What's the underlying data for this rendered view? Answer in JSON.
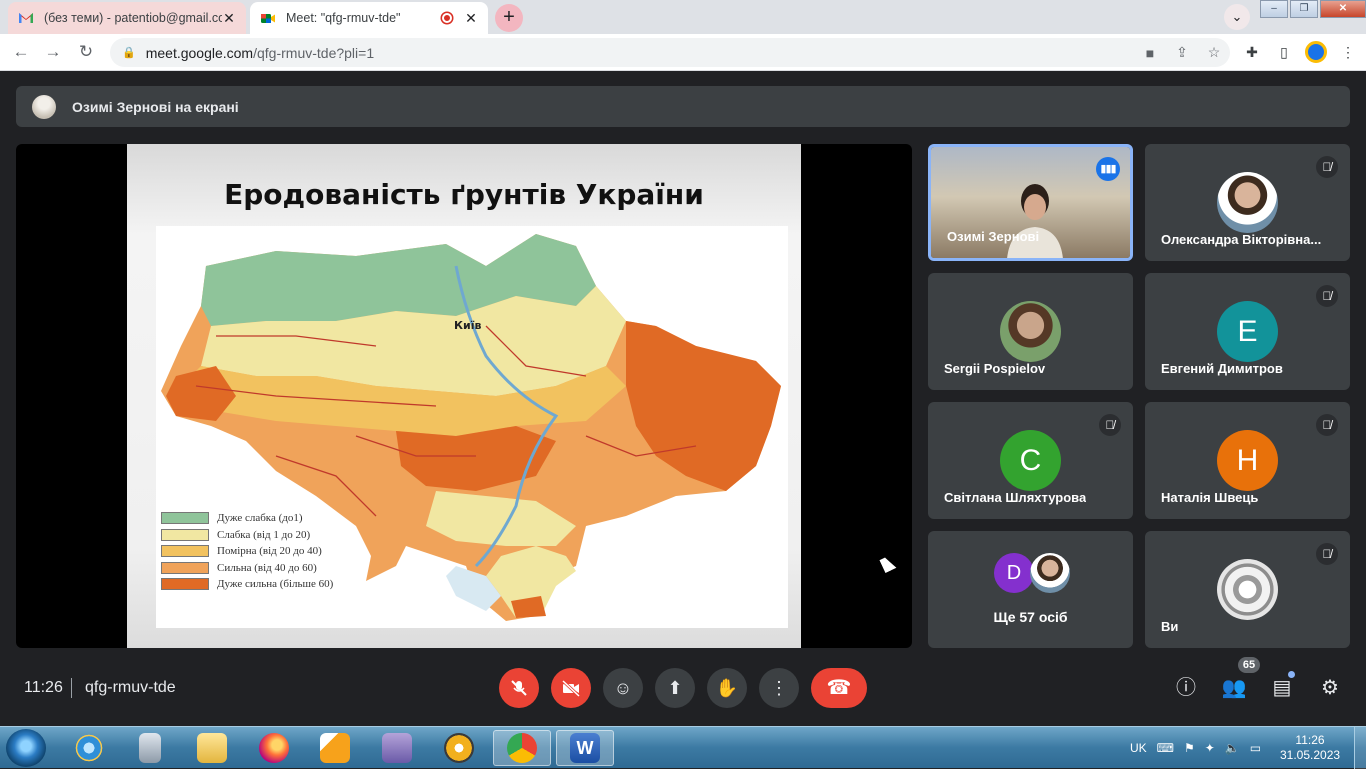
{
  "browser": {
    "tabs": [
      {
        "title": "(без теми) - patentiob@gmail.co",
        "icon": "gmail-icon"
      },
      {
        "title": "Meet: \"qfg-rmuv-tde\"",
        "icon": "meet-icon",
        "recording": true
      }
    ],
    "close_glyph": "✕",
    "new_tab_glyph": "+",
    "address": {
      "host": "meet.google.com",
      "path": "/qfg-rmuv-tde?pli=1"
    }
  },
  "meet": {
    "presenting_label": "Озимі Зернові на екрані",
    "slide": {
      "title": "Еродованість ґрунтів України",
      "city_label": "Київ",
      "legend": [
        {
          "label": "Дуже слабка (до1)",
          "color": "#8fc49a"
        },
        {
          "label": "Слабка (від 1 до 20)",
          "color": "#f1e7a2"
        },
        {
          "label": "Помірна (від 20 до 40)",
          "color": "#f2c25f"
        },
        {
          "label": "Сильна (від 40 до 60)",
          "color": "#f0a35a"
        },
        {
          "label": "Дуже сильна (більше 60)",
          "color": "#e06a25"
        }
      ]
    },
    "participants": [
      {
        "name": "Озимі Зернові",
        "type": "video",
        "speaking": true
      },
      {
        "name": "Олександра Вікторівна...",
        "type": "photo",
        "muted": true
      },
      {
        "name": "Sergii Pospielov",
        "type": "photo",
        "muted": false
      },
      {
        "name": "Евгений Димитров",
        "type": "initial",
        "initial": "E",
        "color": "#12939a",
        "muted": true
      },
      {
        "name": "Світлана Шляхтурова",
        "type": "initial",
        "initial": "C",
        "color": "#33a32f",
        "muted": true
      },
      {
        "name": "Наталія Швець",
        "type": "initial",
        "initial": "Н",
        "color": "#e8710a",
        "muted": true
      },
      {
        "name": "Ви",
        "type": "avatar",
        "muted": true
      }
    ],
    "more": {
      "label": "Ще 57 осіб",
      "initial": "D",
      "color": "#8430ce"
    },
    "time": "11:26",
    "meeting_code": "qfg-rmuv-tde",
    "participant_count": "65"
  },
  "taskbar": {
    "language": "UK",
    "time": "11:26",
    "date": "31.05.2023"
  }
}
